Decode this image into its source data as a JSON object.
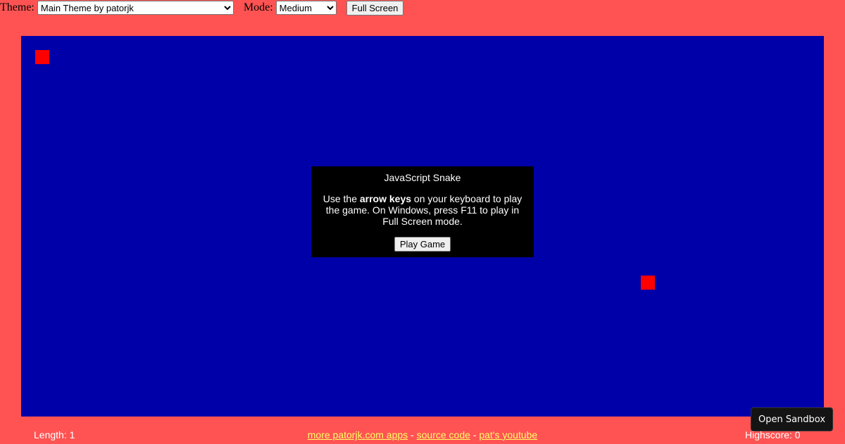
{
  "toolbar": {
    "theme_label": "Theme:",
    "theme_selected": "Main Theme by patorjk",
    "mode_label": "Mode:",
    "mode_selected": "Medium",
    "fullscreen_label": "Full Screen"
  },
  "game": {
    "colors": {
      "page_background": "#ff5353",
      "board": "#0000a8",
      "snake": "#ff0000",
      "food": "#ff0000",
      "dialog": "#000000",
      "link": "#ffff66"
    }
  },
  "dialog": {
    "title": "JavaScript Snake",
    "body_prefix": "Use the ",
    "body_bold": "arrow keys",
    "body_suffix": " on your keyboard to play the game. On Windows, press F11 to play in Full Screen mode.",
    "play_label": "Play Game"
  },
  "footer": {
    "length_text": "Length: 1",
    "link_more": "more patorjk.com apps",
    "separator1": " - ",
    "link_source": "source code",
    "separator2": " - ",
    "link_youtube": "pat's youtube",
    "highscore_text": "Highscore: 0"
  },
  "sandbox": {
    "label": "Open Sandbox"
  }
}
